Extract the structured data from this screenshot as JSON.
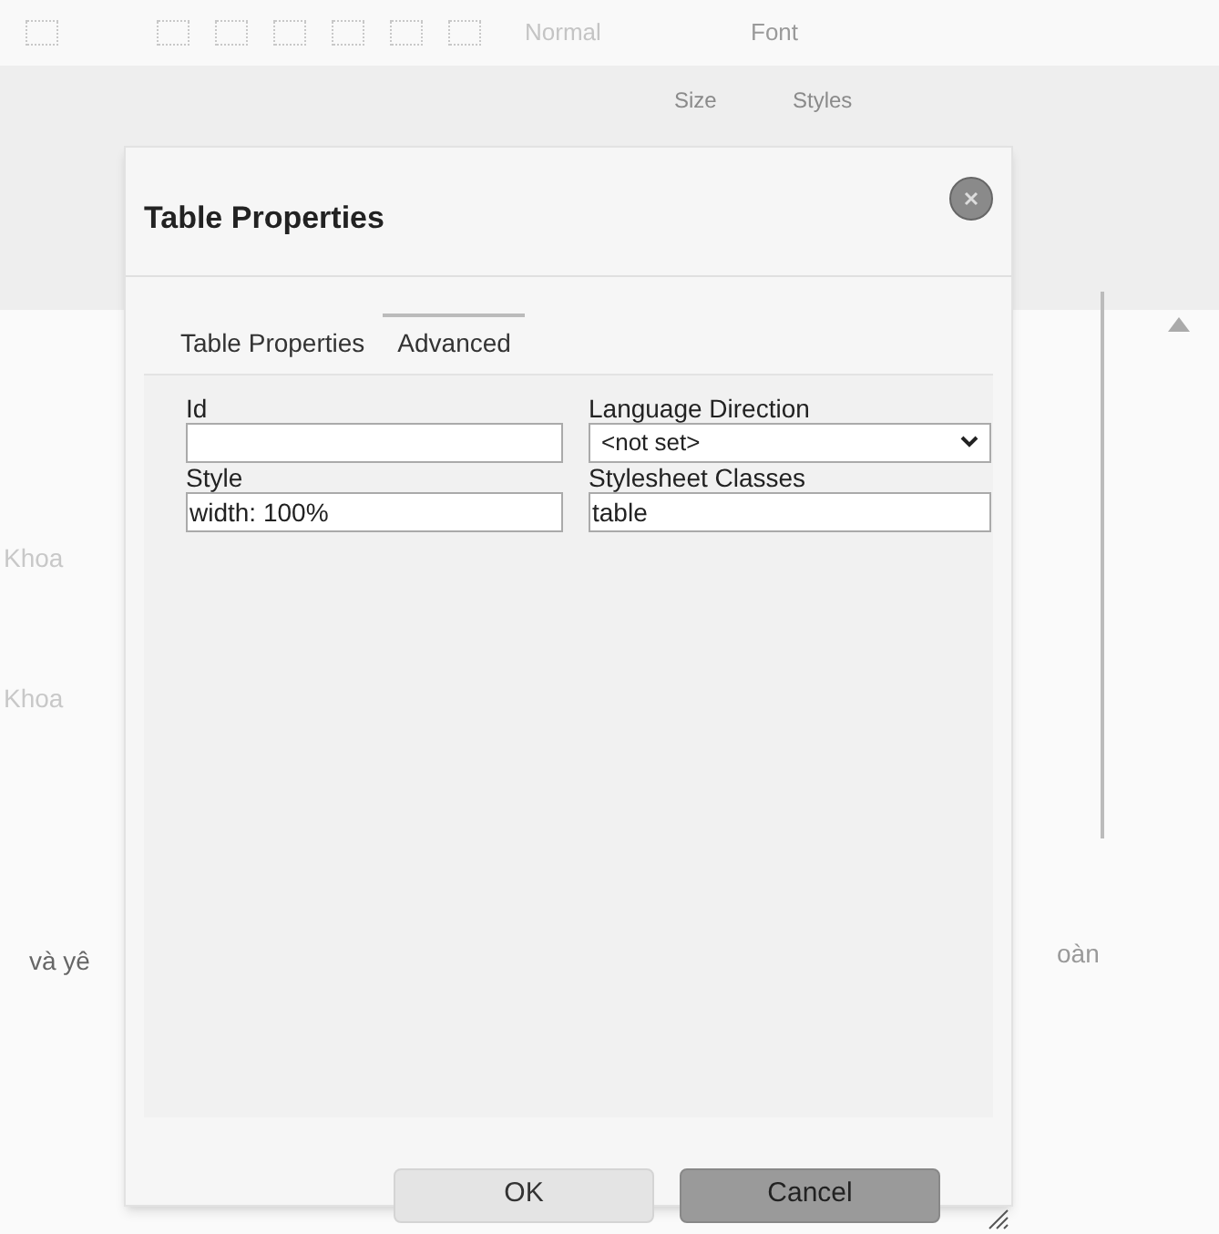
{
  "editor": {
    "toolbar": {
      "format": "Normal",
      "font": "Font",
      "size": "Size",
      "styles": "Styles"
    },
    "text_fragments": [
      {
        "text": "Khoa"
      },
      {
        "text": "Khoa"
      },
      {
        "text": "và yê"
      },
      {
        "text": "oàn"
      }
    ]
  },
  "dialog": {
    "title": "Table Properties",
    "tabs": [
      {
        "label": "Table Properties",
        "selected": false
      },
      {
        "label": "Advanced",
        "selected": true
      }
    ],
    "fields": [
      {
        "kind": "input",
        "label": "Id"
      },
      {
        "kind": "select",
        "label": "Language Direction",
        "value": "<not set>"
      },
      {
        "kind": "input",
        "label": "Style",
        "value": "width: 100%"
      },
      {
        "kind": "input",
        "label": "Stylesheet Classes",
        "value": "table"
      }
    ],
    "buttons": [
      {
        "kind": "primary",
        "label": "OK"
      },
      {
        "kind": "secondary",
        "label": "Cancel"
      }
    ]
  }
}
